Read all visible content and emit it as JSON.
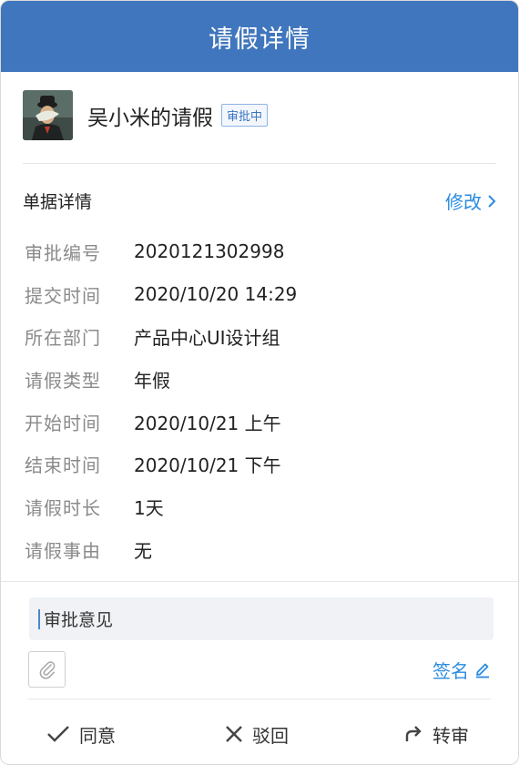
{
  "header": {
    "title": "请假详情"
  },
  "applicant": {
    "name": "吴小米的请假",
    "status": "审批中"
  },
  "section": {
    "title": "单据详情",
    "edit_label": "修改"
  },
  "details": [
    {
      "label": "审批编号",
      "value": "2020121302998"
    },
    {
      "label": "提交时间",
      "value": "2020/10/20 14:29"
    },
    {
      "label": "所在部门",
      "value": "产品中心UI设计组"
    },
    {
      "label": "请假类型",
      "value": "年假"
    },
    {
      "label": "开始时间",
      "value": "2020/10/21 上午"
    },
    {
      "label": "结束时间",
      "value": "2020/10/21 下午"
    },
    {
      "label": "请假时长",
      "value": "1天"
    },
    {
      "label": "请假事由",
      "value": "无"
    }
  ],
  "opinion": {
    "text": "审批意见"
  },
  "signature": {
    "label": "签名"
  },
  "actions": {
    "approve": "同意",
    "reject": "驳回",
    "transfer": "转审"
  },
  "colors": {
    "header_bg": "#4076bd",
    "link": "#2a8be0",
    "badge_border": "#8fb3e0"
  },
  "icons": {
    "attach": "paperclip-icon",
    "sign": "pen-icon",
    "edit": "chevron-right-icon",
    "approve": "check-icon",
    "reject": "close-icon",
    "transfer": "redo-arrow-icon"
  }
}
